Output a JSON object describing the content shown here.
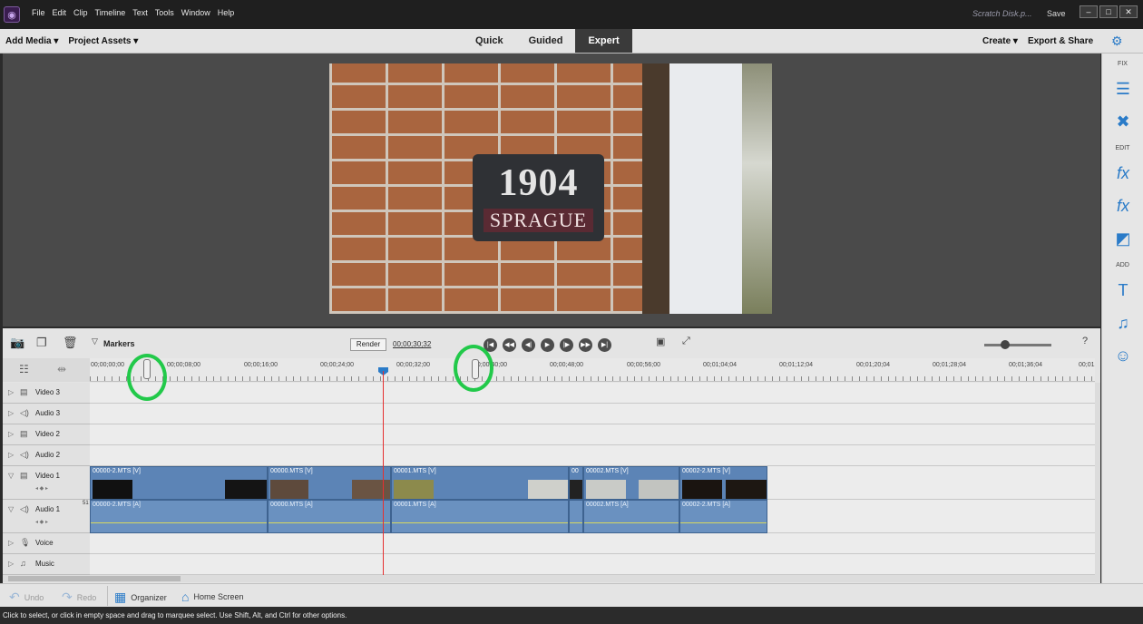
{
  "menu": [
    "File",
    "Edit",
    "Clip",
    "Timeline",
    "Text",
    "Tools",
    "Window",
    "Help"
  ],
  "titlebar": {
    "scratch": "Scratch Disk.p...",
    "save": "Save"
  },
  "modebar": {
    "add_media": "Add Media ▾",
    "project_assets": "Project Assets ▾",
    "tabs": [
      "Quick",
      "Guided",
      "Expert"
    ],
    "active_tab": "Expert",
    "create": "Create ▾",
    "export_share": "Export & Share"
  },
  "preview": {
    "sign_number": "1904",
    "sign_street": "SPRAGUE"
  },
  "rightpanel": {
    "fix_label": "FIX",
    "edit_label": "EDIT",
    "add_label": "ADD"
  },
  "timeline": {
    "markers_label": "Markers",
    "render_label": "Render",
    "timecode": "00;00;30;32",
    "ruler_ticks": [
      "00;00;00;00",
      "00;00;08;00",
      "00;00;16;00",
      "00;00;24;00",
      "00;00;32;00",
      "00;00;40;00",
      "00;00;48;00",
      "00;00;56;00",
      "00;01;04;04",
      "00;01;12;04",
      "00;01;20;04",
      "00;01;28;04",
      "00;01;36;04",
      "00;01"
    ],
    "tracks": [
      "Video 3",
      "Audio 3",
      "Video 2",
      "Audio 2",
      "Video 1",
      "Audio 1",
      "Voice",
      "Music"
    ],
    "video_clips": [
      "00000-2.MTS [V]",
      "00000.MTS [V]",
      "00001.MTS [V]",
      "00",
      "00002.MTS [V]",
      "00002-2.MTS [V]"
    ],
    "audio_clips": [
      "00000-2.MTS [A]",
      "00000.MTS [A]",
      "00001.MTS [A]",
      "00002.MTS [A]",
      "00002-2.MTS [A]"
    ],
    "audio_gap": "51"
  },
  "bottombar": {
    "undo": "Undo",
    "redo": "Redo",
    "organizer": "Organizer",
    "home_screen": "Home Screen"
  },
  "status": "Click to select, or click in empty space and drag to marquee select. Use Shift, Alt, and Ctrl for other options.",
  "colors": {
    "accent": "#2a7bc8",
    "clip": "#5c84b6",
    "playhead": "#e53030",
    "highlight": "#22c94a"
  }
}
